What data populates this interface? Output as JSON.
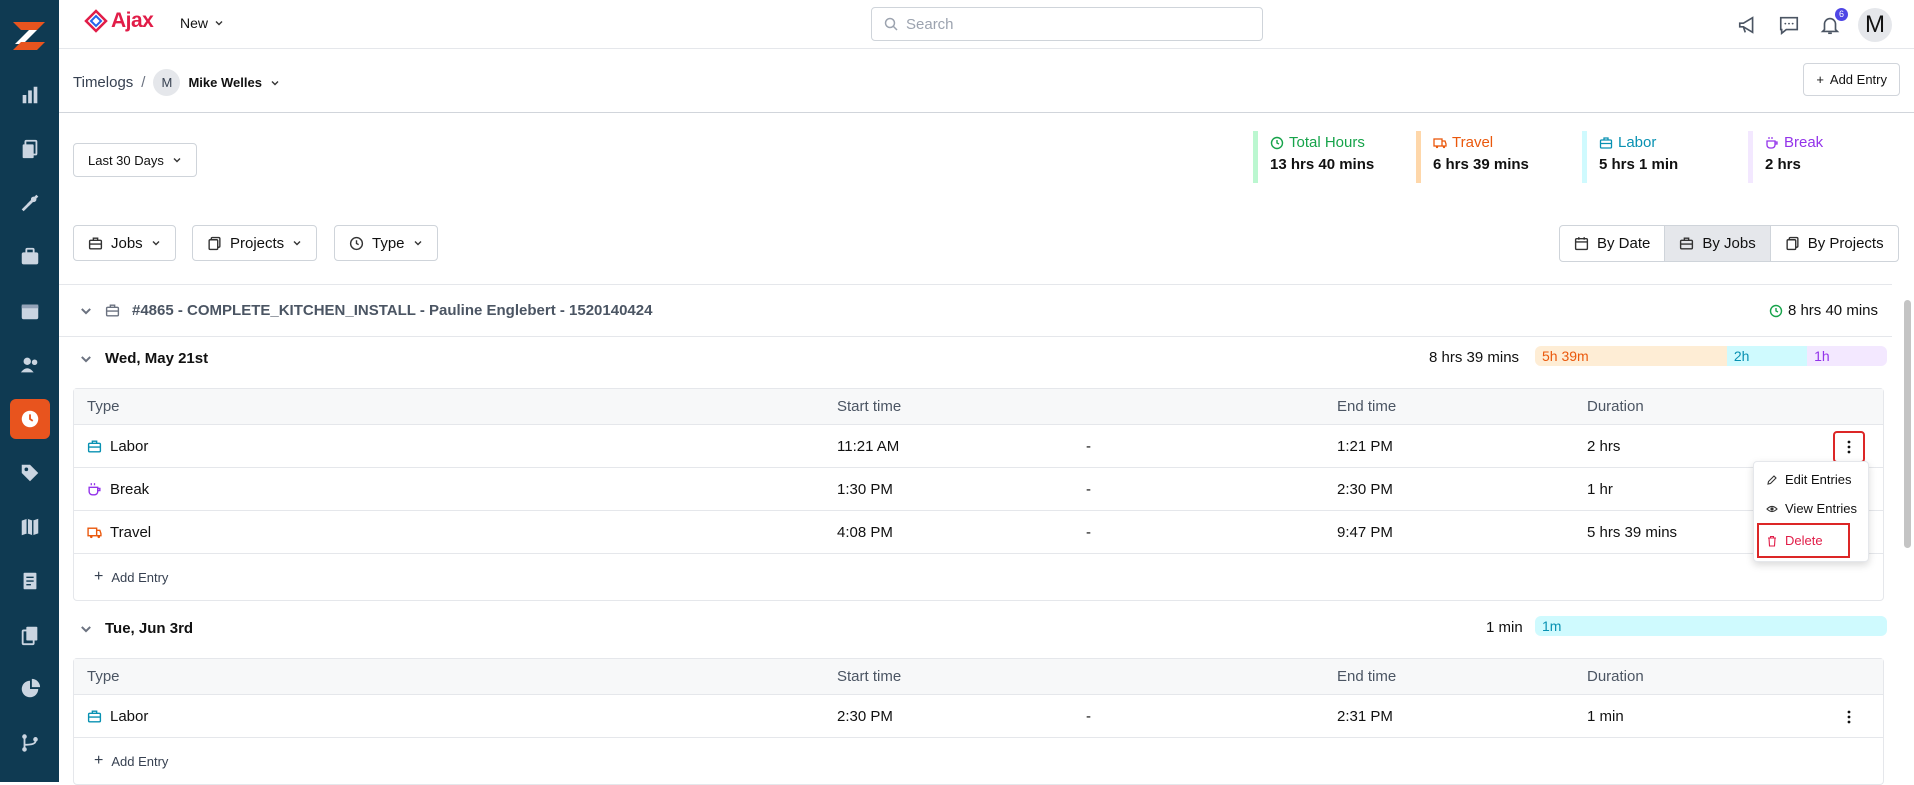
{
  "topbar": {
    "brand": "Ajax",
    "new_label": "New",
    "search_placeholder": "Search",
    "notification_count": "6",
    "avatar_initial": "M"
  },
  "breadcrumb": {
    "root": "Timelogs",
    "separator": "/",
    "user_initial": "M",
    "user_name": "Mike Welles",
    "add_entry": "Add Entry"
  },
  "filters": {
    "date_range": "Last 30 Days",
    "jobs": "Jobs",
    "projects": "Projects",
    "type": "Type"
  },
  "stats": [
    {
      "label": "Total Hours",
      "value": "13 hrs 40 mins",
      "color": "#16a34a"
    },
    {
      "label": "Travel",
      "value": "6 hrs 39 mins",
      "color": "#ea580c"
    },
    {
      "label": "Labor",
      "value": "5 hrs 1 min",
      "color": "#0891b2"
    },
    {
      "label": "Break",
      "value": "2 hrs",
      "color": "#9333ea"
    }
  ],
  "view_toggle": {
    "by_date": "By Date",
    "by_jobs": "By Jobs",
    "by_projects": "By Projects",
    "selected": "By Jobs"
  },
  "job": {
    "title": "#4865 - COMPLETE_KITCHEN_INSTALL - Pauline Englebert - 1520140424",
    "total": "8 hrs 40 mins"
  },
  "columns": {
    "type": "Type",
    "start": "Start time",
    "end": "End time",
    "duration": "Duration"
  },
  "days": [
    {
      "title": "Wed, May 21st",
      "total": "8 hrs 39 mins",
      "bar": [
        {
          "label": "5h 39m",
          "fraction": 0.545
        },
        {
          "label": "2h",
          "fraction": 0.228
        },
        {
          "label": "1h",
          "fraction": 0.227
        }
      ],
      "rows": [
        {
          "type": "Labor",
          "start": "11:21 AM",
          "dash": "-",
          "end": "1:21 PM",
          "duration": "2 hrs"
        },
        {
          "type": "Break",
          "start": "1:30 PM",
          "dash": "-",
          "end": "2:30 PM",
          "duration": "1 hr"
        },
        {
          "type": "Travel",
          "start": "4:08 PM",
          "dash": "-",
          "end": "9:47 PM",
          "duration": "5 hrs 39 mins"
        }
      ],
      "add_entry": "Add Entry"
    },
    {
      "title": "Tue, Jun 3rd",
      "total": "1 min",
      "bar": [
        {
          "label": "1m",
          "fraction": 1.0
        }
      ],
      "rows": [
        {
          "type": "Labor",
          "start": "2:30 PM",
          "dash": "-",
          "end": "2:31 PM",
          "duration": "1 min"
        }
      ],
      "add_entry": "Add Entry"
    }
  ],
  "row_menu": {
    "edit": "Edit Entries",
    "view": "View Entries",
    "delete": "Delete"
  },
  "colors": {
    "sidebar": "#0f3a52",
    "accent": "#e8541e",
    "labor": "#0891b2",
    "break": "#9333ea",
    "travel": "#ea580c",
    "total": "#16a34a"
  }
}
